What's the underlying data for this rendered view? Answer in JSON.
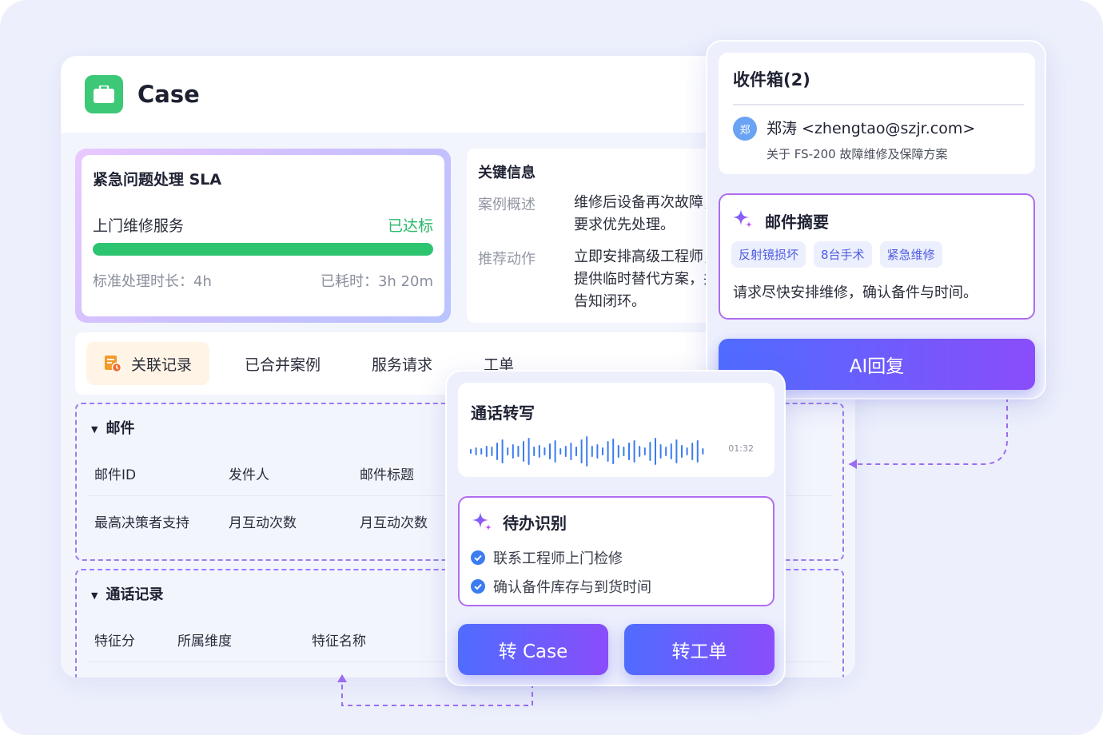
{
  "case": {
    "title": "Case",
    "sla": {
      "title": "紧急问题处理 SLA",
      "service": "上门维修服务",
      "status": "已达标",
      "progress": 1.0,
      "standard": "标准处理时长：4h",
      "used": "已耗时：3h 20m"
    },
    "key_info": {
      "title": "关键信息",
      "overview_label": "案例概述",
      "overview_value": "维修后设备再次故障，要求优先处理。",
      "action_label": "推荐动作",
      "action_value": "立即安排高级工程师，提供临时替代方案，并告知闭环。"
    },
    "tabs": [
      "关联记录",
      "已合并案例",
      "服务请求",
      "工单"
    ],
    "email_section": {
      "title": "邮件",
      "columns": [
        "邮件ID",
        "发件人",
        "邮件标题"
      ],
      "row": [
        "最高决策者支持",
        "月互动次数",
        "月互动次数"
      ]
    },
    "call_section": {
      "title": "通话记录",
      "columns": [
        "特征分",
        "所属维度",
        "特征名称"
      ]
    }
  },
  "inbox": {
    "title": "收件箱(2)",
    "avatar": "郑",
    "sender": "郑涛 <zhengtao@szjr.com>",
    "subject": "关于 FS-200 故障维修及保障方案",
    "summary": {
      "title": "邮件摘要",
      "tags": [
        "反射镜损坏",
        "8台手术",
        "紧急维修"
      ],
      "text": "请求尽快安排维修，确认备件与时间。"
    },
    "ai_button": "AI回复"
  },
  "call": {
    "title": "通话转写",
    "duration": "01:32",
    "todo": {
      "title": "待办识别",
      "items": [
        "联系工程师上门检修",
        "确认备件库存与到货时间"
      ]
    },
    "to_case": "转 Case",
    "to_ticket": "转工单"
  },
  "colors": {
    "accent_start": "#4f6cff",
    "accent_end": "#8a4dfb",
    "success": "#2dc470",
    "dashed": "#9b7cf0",
    "case_logo": "#3cc877"
  }
}
